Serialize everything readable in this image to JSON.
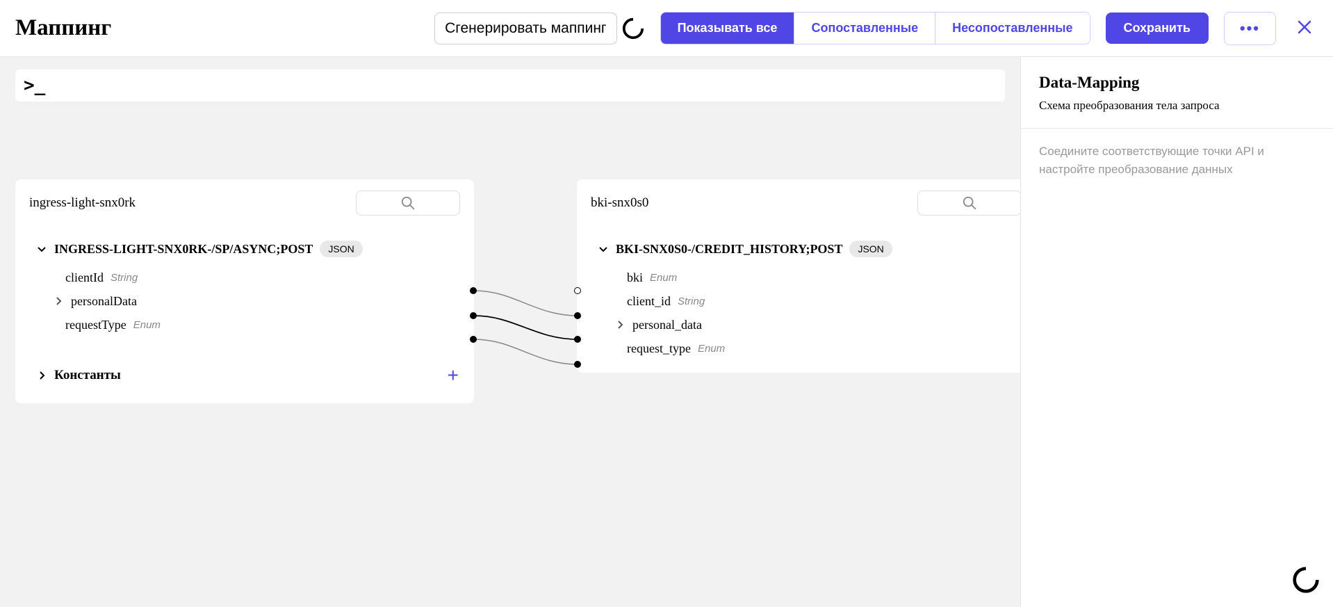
{
  "header": {
    "title": "Маппинг",
    "generate_label": "Сгенерировать маппинг",
    "filters": {
      "show_all": "Показывать все",
      "matched": "Сопоставленные",
      "unmatched": "Несопоставленные"
    },
    "save_label": "Сохранить"
  },
  "left_panel": {
    "name": "ingress-light-snx0rk",
    "endpoint": "INGRESS-LIGHT-SNX0RK-/SP/ASYNC;POST",
    "badge": "JSON",
    "fields": [
      {
        "name": "clientId",
        "type": "String"
      },
      {
        "name": "personalData",
        "type": ""
      },
      {
        "name": "requestType",
        "type": "Enum"
      }
    ],
    "constants_label": "Константы"
  },
  "right_panel": {
    "name": "bki-snx0s0",
    "endpoint": "BKI-SNX0S0-/CREDIT_HISTORY;POST",
    "badge": "JSON",
    "fields": [
      {
        "name": "bki",
        "type": "Enum"
      },
      {
        "name": "client_id",
        "type": "String"
      },
      {
        "name": "personal_data",
        "type": ""
      },
      {
        "name": "request_type",
        "type": "Enum"
      }
    ]
  },
  "sidebar": {
    "title": "Data-Mapping",
    "subtitle": "Схема преобразования тела запроса",
    "hint": "Соедините соответствующие точки API и настройте преобразование данных"
  }
}
